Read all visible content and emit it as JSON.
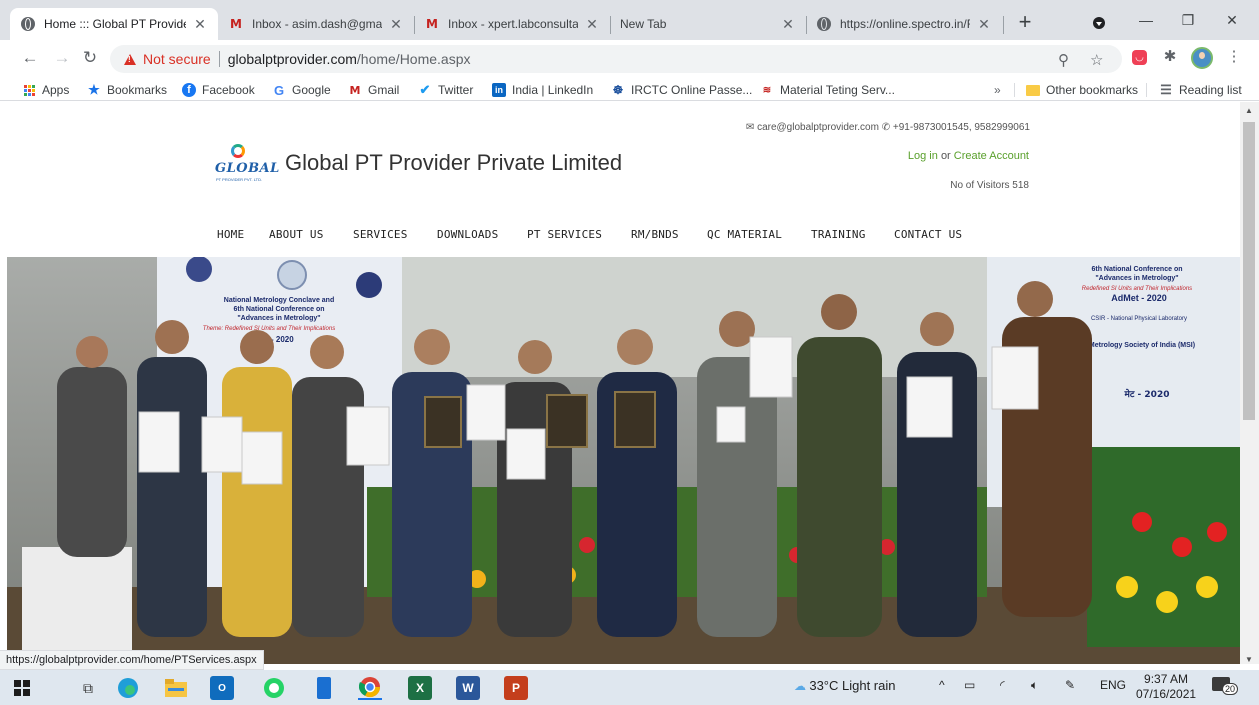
{
  "tabs": [
    {
      "title": "Home ::: Global PT Provide",
      "icon": "globe-icon",
      "active": true
    },
    {
      "title": "Inbox - asim.dash@gmail.",
      "icon": "gmail-icon"
    },
    {
      "title": "Inbox - xpert.labconsultan",
      "icon": "gmail-icon"
    },
    {
      "title": "New Tab",
      "icon": ""
    },
    {
      "title": "https://online.spectro.in/R",
      "icon": "globe-icon"
    }
  ],
  "new_tab_symbol": "+",
  "window_controls": {
    "minimize": "—",
    "restore": "❐",
    "close": "✕"
  },
  "address_bar": {
    "security_label": "Not secure",
    "host": "globalptprovider.com",
    "path": "/home/Home.aspx"
  },
  "bookmarks": [
    {
      "label": "Apps",
      "icon": "apps-grid-icon"
    },
    {
      "label": "Bookmarks",
      "icon": "star-icon"
    },
    {
      "label": "Facebook",
      "icon": "facebook-icon"
    },
    {
      "label": "Google",
      "icon": "google-icon"
    },
    {
      "label": "Gmail",
      "icon": "gmail-icon"
    },
    {
      "label": "Twitter",
      "icon": "twitter-icon"
    },
    {
      "label": "India | LinkedIn",
      "icon": "linkedin-icon"
    },
    {
      "label": "IRCTC Online Passe...",
      "icon": "irctc-icon"
    },
    {
      "label": "Material Teting Serv...",
      "icon": "bookmark-site-icon"
    }
  ],
  "bookmarks_overflow": "»",
  "other_bookmarks": "Other bookmarks",
  "reading_list": "Reading list",
  "site": {
    "email": "care@globalptprovider.com",
    "phone": "+91-9873001545, 9582999061",
    "login": "Log in",
    "or": "or",
    "create_account": "Create Account",
    "visitors": "No of Visitors 518",
    "logo_text": "GLOBAL",
    "logo_sub": "PT PROVIDER PVT. LTD.",
    "title": "Global PT Provider Private Limited",
    "nav": [
      "HOME",
      "ABOUT US",
      "SERVICES",
      "DOWNLOADS",
      "PT SERVICES",
      "RM/BNDS",
      "QC MATERIAL",
      "TRAINING",
      "CONTACT US"
    ]
  },
  "hero_banner": {
    "left_lines": [
      "National Metrology Conclave and",
      "6th National Conference on",
      "\"Advances in Metrology\"",
      "Theme: Redefined SI Units and Their Implications",
      "AdMet - 2020"
    ],
    "right_lines": [
      "6th National Conference on",
      "\"Advances in Metrology\"",
      "Redefined SI Units and Their Implications",
      "AdMet - 2020",
      "CSIR - National Physical Laboratory",
      "Metrology Society of India (MSI)",
      "मेट - 2020"
    ]
  },
  "status_url": "https://globalptprovider.com/home/PTServices.aspx",
  "taskbar": {
    "weather": "33°C  Light rain",
    "lang": "ENG",
    "time": "9:37 AM",
    "date": "07/16/2021",
    "notifications": "20"
  },
  "colors": {
    "tabstrip": "#dee1e6",
    "not_secure": "#d93025",
    "link_green": "#5aa02c",
    "taskbar": "#dfe7ef"
  }
}
